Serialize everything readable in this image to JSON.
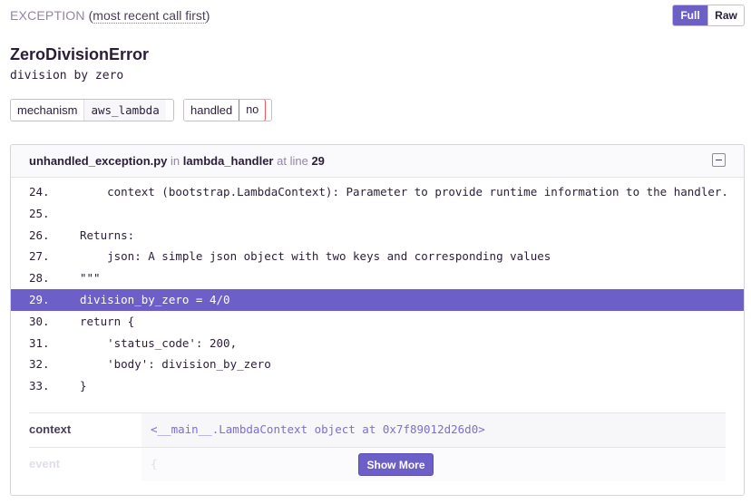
{
  "header": {
    "title": "EXCEPTION",
    "paren_open": "(",
    "subtitle_link": "most recent call first",
    "paren_close": ")"
  },
  "view_toggle": {
    "full_label": "Full",
    "raw_label": "Raw",
    "selected": "Full"
  },
  "exception": {
    "type": "ZeroDivisionError",
    "message": "division by zero"
  },
  "tags": [
    {
      "key": "mechanism",
      "value": "aws_lambda"
    },
    {
      "key": "handled",
      "value": "no"
    }
  ],
  "frame": {
    "filename": "unhandled_exception.py",
    "in_text": "in",
    "function": "lambda_handler",
    "at_line_text": "at line",
    "line_number": "29",
    "active_line": "29",
    "lines": [
      {
        "num": "24.",
        "code": "    context (bootstrap.LambdaContext): Parameter to provide runtime information to the handler."
      },
      {
        "num": "25.",
        "code": ""
      },
      {
        "num": "26.",
        "code": "Returns:"
      },
      {
        "num": "27.",
        "code": "    json: A simple json object with two keys and corresponding values"
      },
      {
        "num": "28.",
        "code": "\"\"\""
      },
      {
        "num": "29.",
        "code": "division_by_zero = 4/0"
      },
      {
        "num": "30.",
        "code": "return {"
      },
      {
        "num": "31.",
        "code": "    'status_code': 200,"
      },
      {
        "num": "32.",
        "code": "    'body': division_by_zero"
      },
      {
        "num": "33.",
        "code": "}"
      }
    ],
    "variables": [
      {
        "key": "context",
        "value": "<__main__.LambdaContext object at 0x7f89012d26d0>"
      },
      {
        "key": "event",
        "value": "{"
      }
    ],
    "show_more_label": "Show More"
  },
  "colors": {
    "accent": "#6c5fc7",
    "handled_no_border": "#f55459"
  },
  "icons": {
    "collapse": "collapse-icon"
  }
}
